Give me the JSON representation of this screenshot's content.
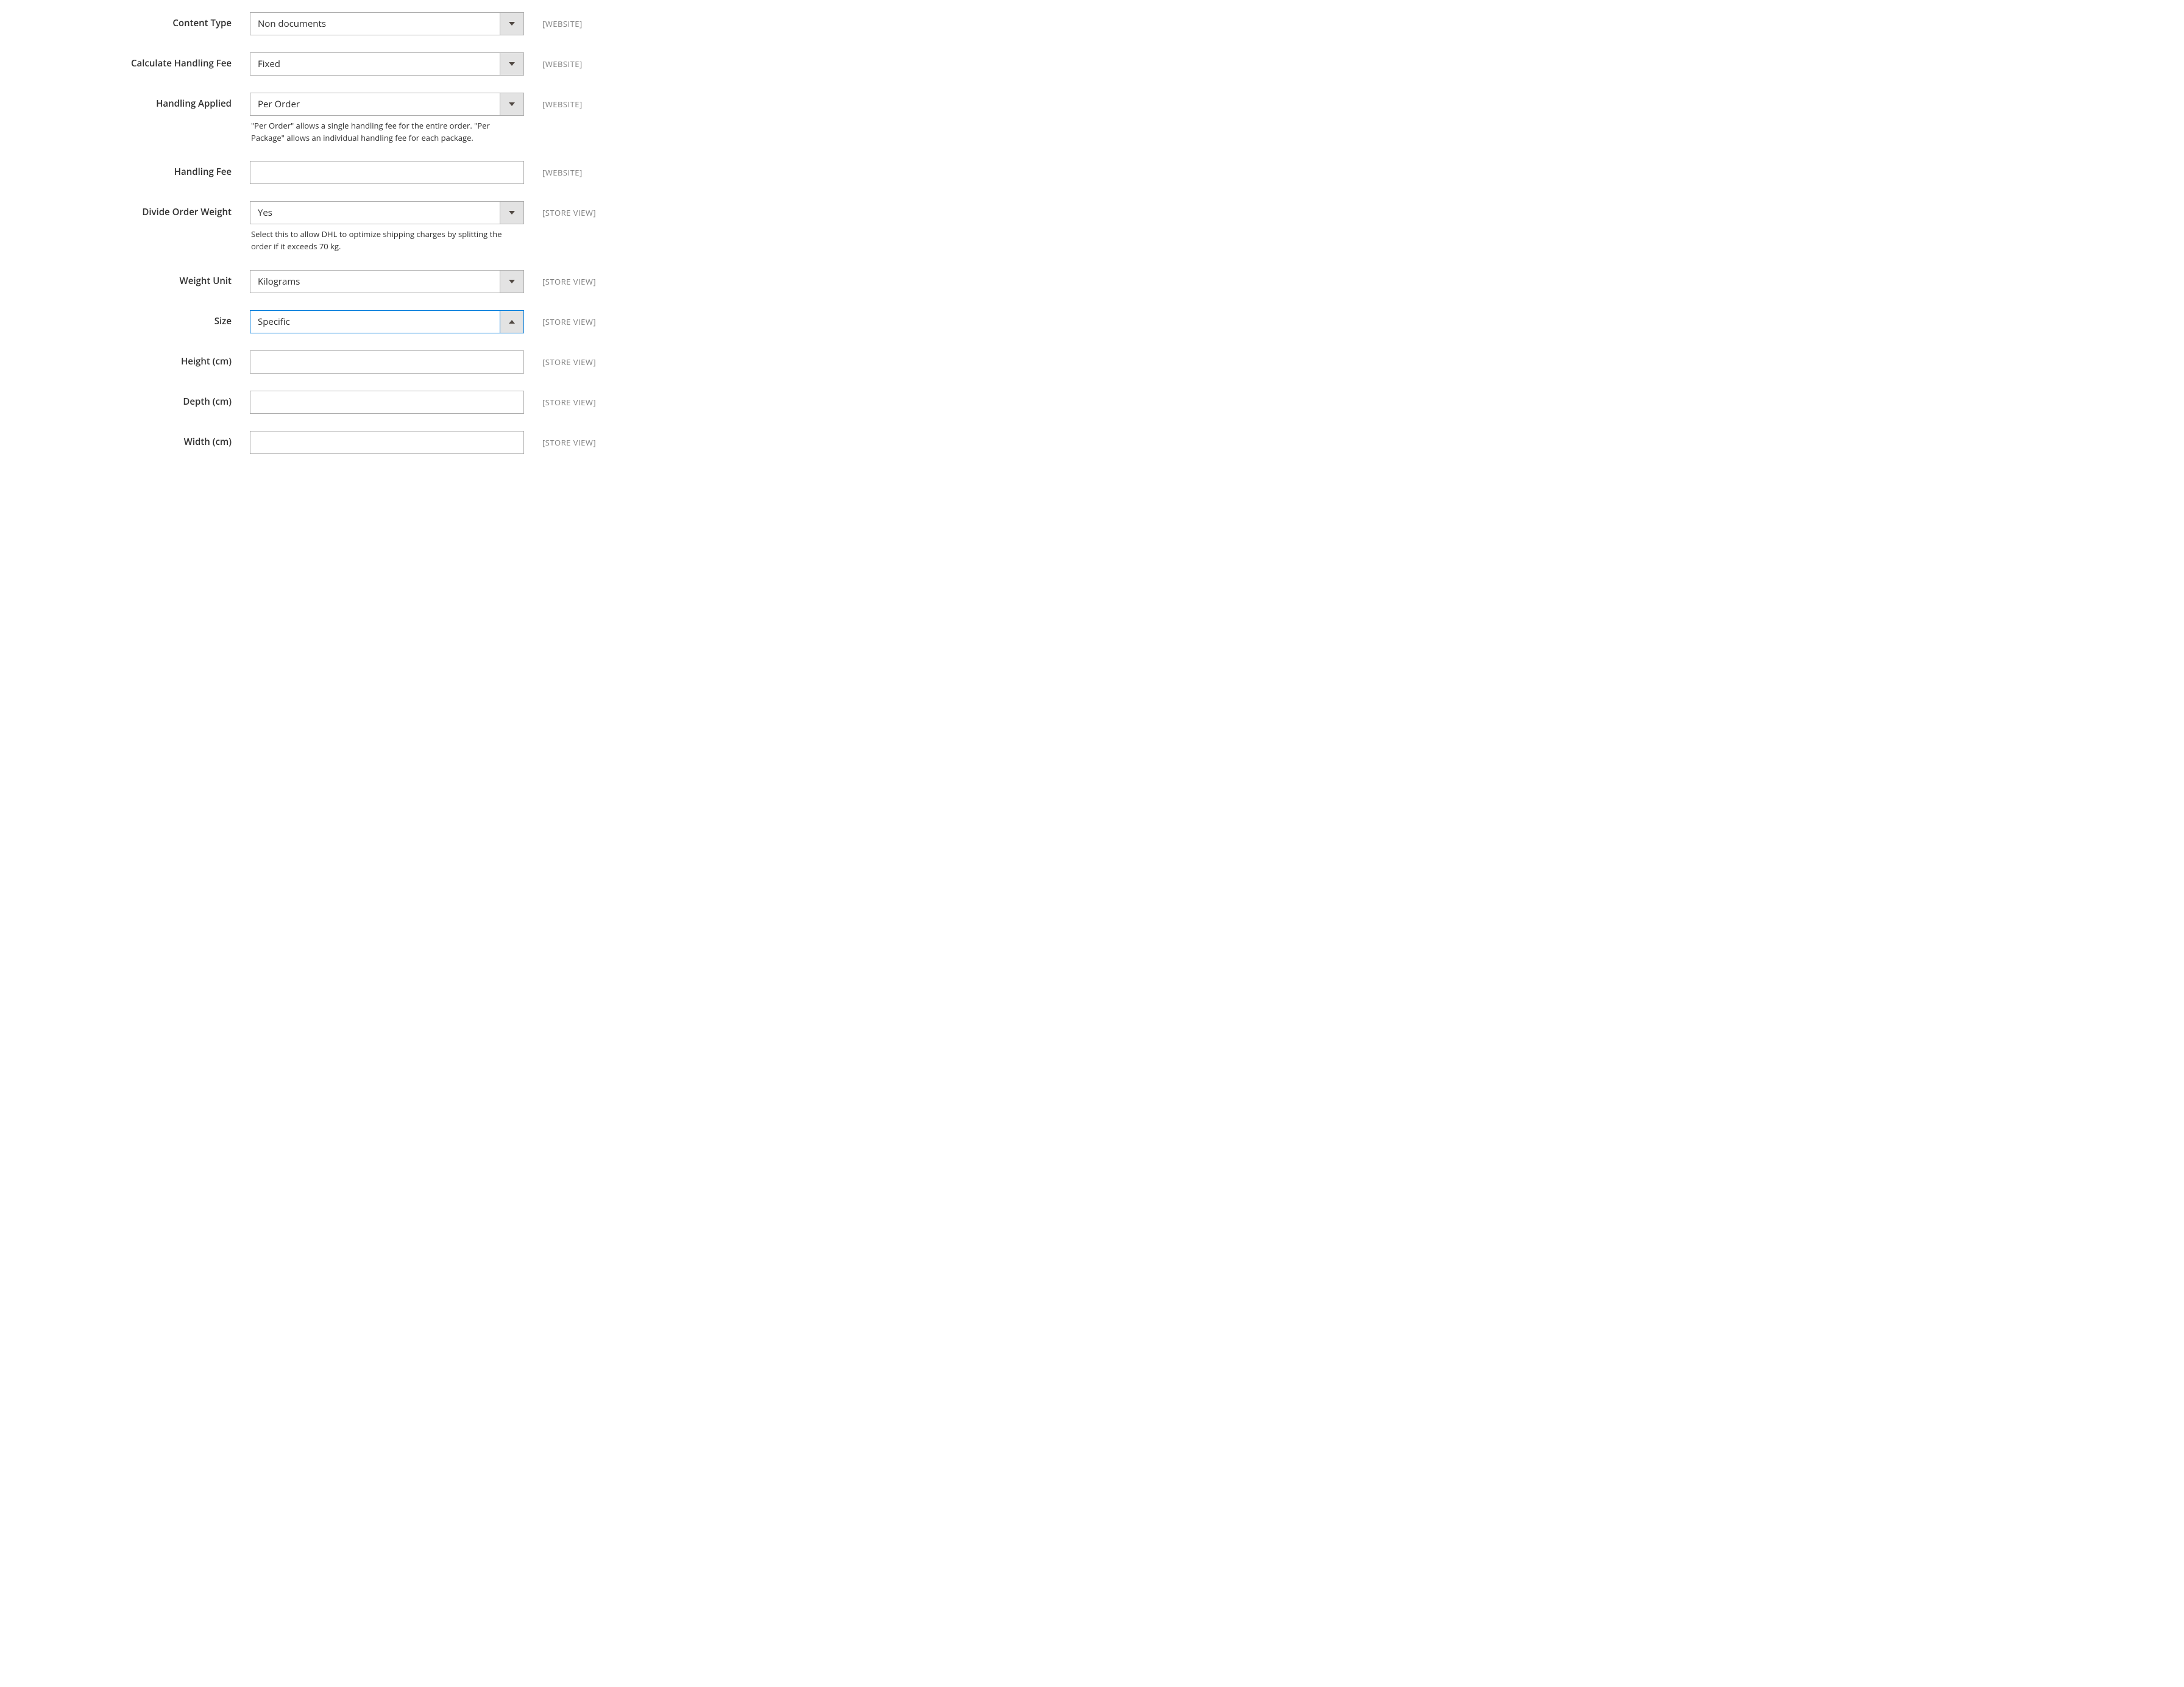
{
  "scopes": {
    "website": "[WEBSITE]",
    "store_view": "[STORE VIEW]"
  },
  "fields": {
    "content_type": {
      "label": "Content Type",
      "value": "Non documents"
    },
    "calc_handling_fee": {
      "label": "Calculate Handling Fee",
      "value": "Fixed"
    },
    "handling_applied": {
      "label": "Handling Applied",
      "value": "Per Order",
      "note": "\"Per Order\" allows a single handling fee for the entire order. \"Per Package\" allows an individual handling fee for each package."
    },
    "handling_fee": {
      "label": "Handling Fee",
      "value": ""
    },
    "divide_order_weight": {
      "label": "Divide Order Weight",
      "value": "Yes",
      "note": "Select this to allow DHL to optimize shipping charges by splitting the order if it exceeds 70 kg."
    },
    "weight_unit": {
      "label": "Weight Unit",
      "value": "Kilograms"
    },
    "size": {
      "label": "Size",
      "value": "Specific"
    },
    "height": {
      "label": "Height (cm)",
      "value": ""
    },
    "depth": {
      "label": "Depth (cm)",
      "value": ""
    },
    "width": {
      "label": "Width (cm)",
      "value": ""
    }
  }
}
